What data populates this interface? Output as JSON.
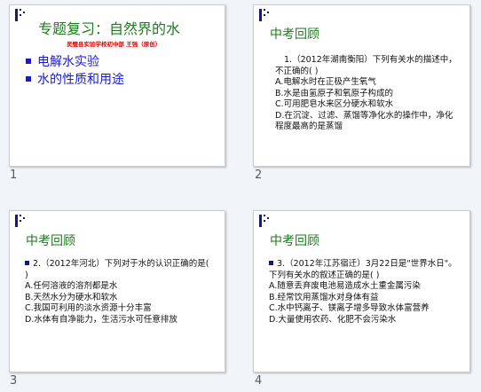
{
  "slides": [
    {
      "number": "1",
      "title": "专题复习：自然界的水",
      "subtitle": "灵璧县实验学校初中部   王强（原创）",
      "bullets": [
        "电解水实验",
        "水的性质和用途"
      ]
    },
    {
      "number": "2",
      "title": "中考回顾",
      "question": "1.（2012年湖南衡阳）下列有关水的描述中，不正确的(    )",
      "options": [
        "A.电解水时在正极产生氧气",
        "B.水是由氢原子和氧原子构成的",
        "C.可用肥皂水来区分硬水和软水",
        "D.在沉淀、过滤、蒸馏等净化水的操作中，净化程度最高的是蒸馏"
      ]
    },
    {
      "number": "3",
      "title": "中考回顾",
      "question": "2.（2012年河北）下列对于水的认识正确的是(    )",
      "options": [
        "A.任何溶液的溶剂都是水",
        "B.天然水分为硬水和软水",
        "C.我国可利用的淡水资源十分丰富",
        "D.水体有自净能力，生活污水可任意排放"
      ]
    },
    {
      "number": "4",
      "title": "中考回顾",
      "question": "3.（2012年江苏宿迁）3月22日是\"世界水日\"。下列有关水的叙述正确的是(    )",
      "options": [
        "A.随意丢弃废电池易造成水土重金属污染",
        "B.经常饮用蒸馏水对身体有益",
        "C.水中钙离子、镁离子增多导致水体富营养",
        "D.大量使用农药、化肥不会污染水"
      ]
    }
  ]
}
